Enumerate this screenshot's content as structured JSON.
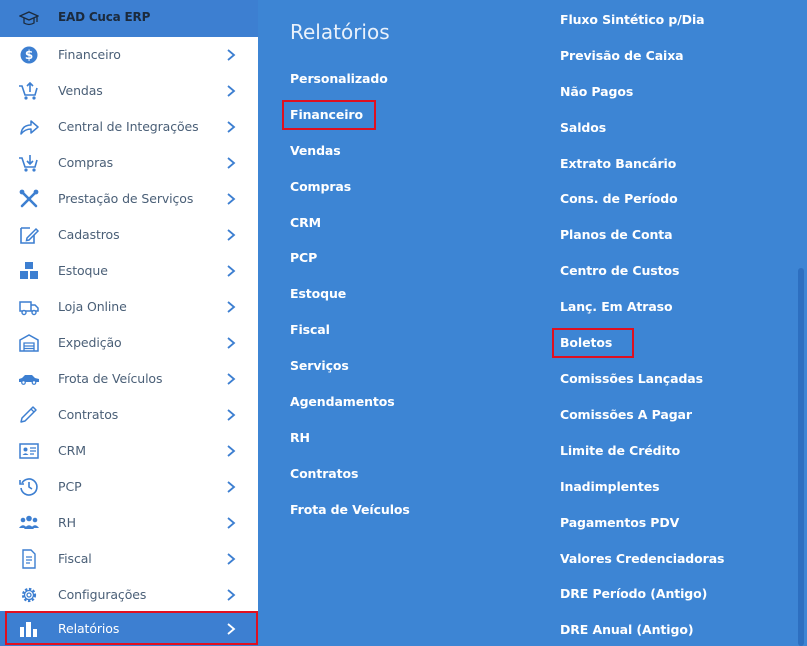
{
  "app": {
    "title": "EAD Cuca ERP",
    "logo_icon": "graduation-cap-icon"
  },
  "sidebar": {
    "items": [
      {
        "label": "Financeiro",
        "icon": "dollar-icon"
      },
      {
        "label": "Vendas",
        "icon": "cart-up-icon"
      },
      {
        "label": "Central de Integrações",
        "icon": "share-icon"
      },
      {
        "label": "Compras",
        "icon": "cart-down-icon"
      },
      {
        "label": "Prestação de Serviços",
        "icon": "tools-icon"
      },
      {
        "label": "Cadastros",
        "icon": "edit-icon"
      },
      {
        "label": "Estoque",
        "icon": "boxes-icon"
      },
      {
        "label": "Loja Online",
        "icon": "truck-icon"
      },
      {
        "label": "Expedição",
        "icon": "warehouse-icon"
      },
      {
        "label": "Frota de Veículos",
        "icon": "car-icon"
      },
      {
        "label": "Contratos",
        "icon": "pen-icon"
      },
      {
        "label": "CRM",
        "icon": "id-card-icon"
      },
      {
        "label": "PCP",
        "icon": "clock-icon"
      },
      {
        "label": "RH",
        "icon": "people-icon"
      },
      {
        "label": "Fiscal",
        "icon": "document-icon"
      },
      {
        "label": "Configurações",
        "icon": "gear-icon"
      },
      {
        "label": "Relatórios",
        "icon": "bar-chart-icon"
      }
    ]
  },
  "reports": {
    "title": "Relatórios",
    "categories": [
      "Personalizado",
      "Financeiro",
      "Vendas",
      "Compras",
      "CRM",
      "PCP",
      "Estoque",
      "Fiscal",
      "Serviços",
      "Agendamentos",
      "RH",
      "Contratos",
      "Frota de Veículos"
    ],
    "items": [
      "Fluxo Sintético p/Dia",
      "Previsão de Caixa",
      "Não Pagos",
      "Saldos",
      "Extrato Bancário",
      "Cons. de Período",
      "Planos de Conta",
      "Centro de Custos",
      "Lanç. Em Atraso",
      "Boletos",
      "Comissões Lançadas",
      "Comissões A Pagar",
      "Limite de Crédito",
      "Inadimplentes",
      "Pagamentos PDV",
      "Valores Credenciadoras",
      "DRE Período (Antigo)",
      "DRE Anual (Antigo)"
    ]
  },
  "colors": {
    "accent": "#3d85d4",
    "highlight": "#e01020",
    "icon": "#3d7fd1"
  }
}
